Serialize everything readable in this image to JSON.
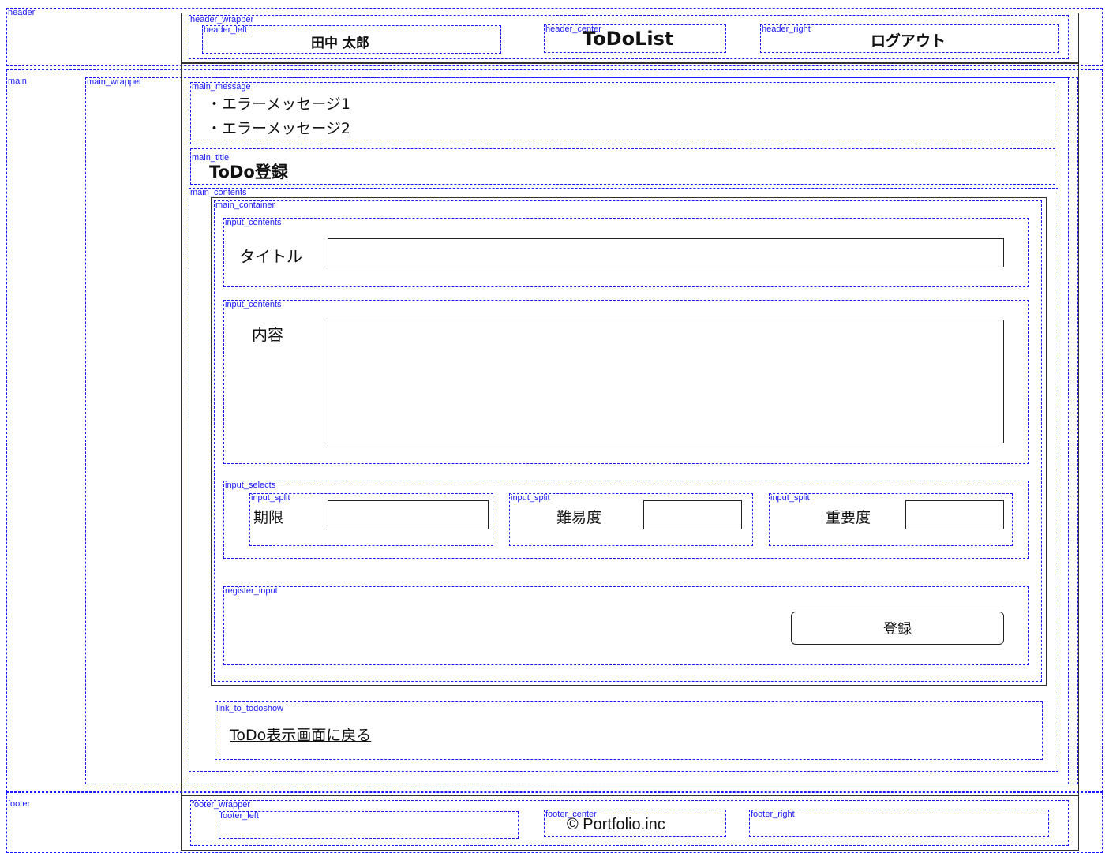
{
  "layout_labels": {
    "header": "header",
    "header_wrapper": "header_wrapper",
    "header_left": "header_left",
    "header_center": "header_center",
    "header_right": "header_right",
    "main": "main",
    "main_wrapper": "main_wrapper",
    "main_message": "main_message",
    "main_title": "main_title",
    "main_contents": "main_contents",
    "main_container": "main_container",
    "input_contents": "input_contents",
    "input_selects": "input_selects",
    "input_split": "input_split",
    "register_input": "register_input",
    "link_to_todoshow": "link_to_todoshow",
    "footer": "footer",
    "footer_wrapper": "footer_wrapper",
    "footer_left": "footer_left",
    "footer_center": "footer_center",
    "footer_right": "footer_right"
  },
  "header": {
    "user_name": "田中 太郎",
    "app_title": "ToDoList",
    "logout_label": "ログアウト"
  },
  "messages": [
    "・エラーメッセージ1",
    "・エラーメッセージ2"
  ],
  "page_title": "ToDo登録",
  "form": {
    "title_label": "タイトル",
    "title_value": "",
    "content_label": "内容",
    "content_value": "",
    "deadline_label": "期限",
    "deadline_value": "",
    "difficulty_label": "難易度",
    "difficulty_value": "",
    "importance_label": "重要度",
    "importance_value": "",
    "register_label": "登録"
  },
  "back_link": "ToDo表示画面に戻る",
  "footer": {
    "copyright": "© Portfolio.inc"
  },
  "colors": {
    "guide": "#1a1aff",
    "border": "#222222",
    "background": "#ffffff"
  }
}
